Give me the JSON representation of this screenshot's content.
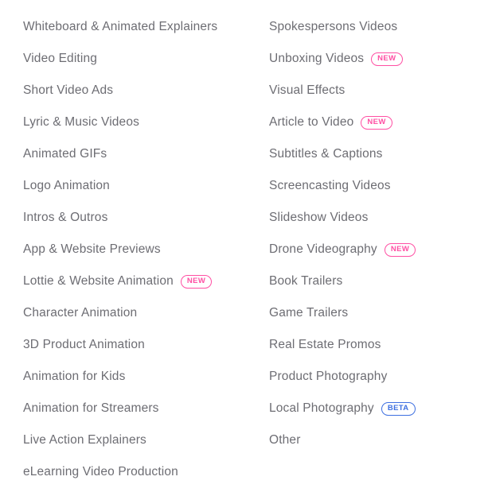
{
  "menu": {
    "columns": [
      {
        "name": "left-column",
        "items": [
          {
            "label": "Whiteboard & Animated Explainers",
            "badge": null
          },
          {
            "label": "Video Editing",
            "badge": null
          },
          {
            "label": "Short Video Ads",
            "badge": null
          },
          {
            "label": "Lyric & Music Videos",
            "badge": null
          },
          {
            "label": "Animated GIFs",
            "badge": null
          },
          {
            "label": "Logo Animation",
            "badge": null
          },
          {
            "label": "Intros & Outros",
            "badge": null
          },
          {
            "label": "App & Website Previews",
            "badge": null
          },
          {
            "label": "Lottie & Website Animation",
            "badge": "NEW"
          },
          {
            "label": "Character Animation",
            "badge": null
          },
          {
            "label": "3D Product Animation",
            "badge": null
          },
          {
            "label": "Animation for Kids",
            "badge": null
          },
          {
            "label": "Animation for Streamers",
            "badge": null
          },
          {
            "label": "Live Action Explainers",
            "badge": null
          },
          {
            "label": "eLearning Video Production",
            "badge": null
          }
        ]
      },
      {
        "name": "right-column",
        "items": [
          {
            "label": "Spokespersons Videos",
            "badge": null
          },
          {
            "label": "Unboxing Videos",
            "badge": "NEW"
          },
          {
            "label": "Visual Effects",
            "badge": null
          },
          {
            "label": "Article to Video",
            "badge": "NEW"
          },
          {
            "label": "Subtitles & Captions",
            "badge": null
          },
          {
            "label": "Screencasting Videos",
            "badge": null
          },
          {
            "label": "Slideshow Videos",
            "badge": null
          },
          {
            "label": "Drone Videography",
            "badge": "NEW"
          },
          {
            "label": "Book Trailers",
            "badge": null
          },
          {
            "label": "Game Trailers",
            "badge": null
          },
          {
            "label": "Real Estate Promos",
            "badge": null
          },
          {
            "label": "Product Photography",
            "badge": null
          },
          {
            "label": "Local Photography",
            "badge": "BETA"
          },
          {
            "label": "Other",
            "badge": null
          }
        ]
      }
    ]
  },
  "colors": {
    "text": "#6d6d73",
    "badge_new": "#ff4fa3",
    "badge_beta": "#3d6fe0",
    "background": "#ffffff"
  }
}
